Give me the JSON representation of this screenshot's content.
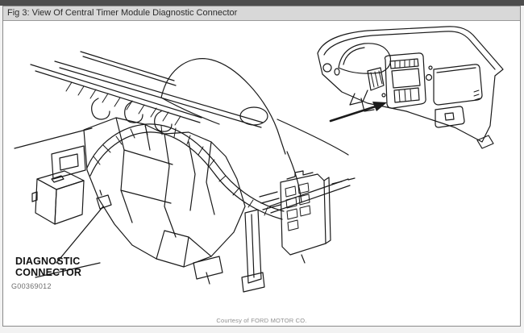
{
  "window": {
    "title": "Fig 3: View Of Central Timer Module Diagnostic Connector"
  },
  "figure": {
    "callout_label": "DIAGNOSTIC\nCONNECTOR",
    "figure_id": "G00369012",
    "credit": "Courtesy of FORD MOTOR CO.",
    "colors": {
      "line_art": "#1a1a1a",
      "titlebar_bg": "#d8d8d8",
      "top_strip": "#4d4d4d",
      "window_border": "#8a8a8a"
    },
    "drawing_subjects": {
      "main_view": "instrument-panel-substructure-with-wiring-harness",
      "inset_view": "dashboard-front-view-with-location-arrow",
      "pointed_part": "diagnostic-connector"
    }
  }
}
